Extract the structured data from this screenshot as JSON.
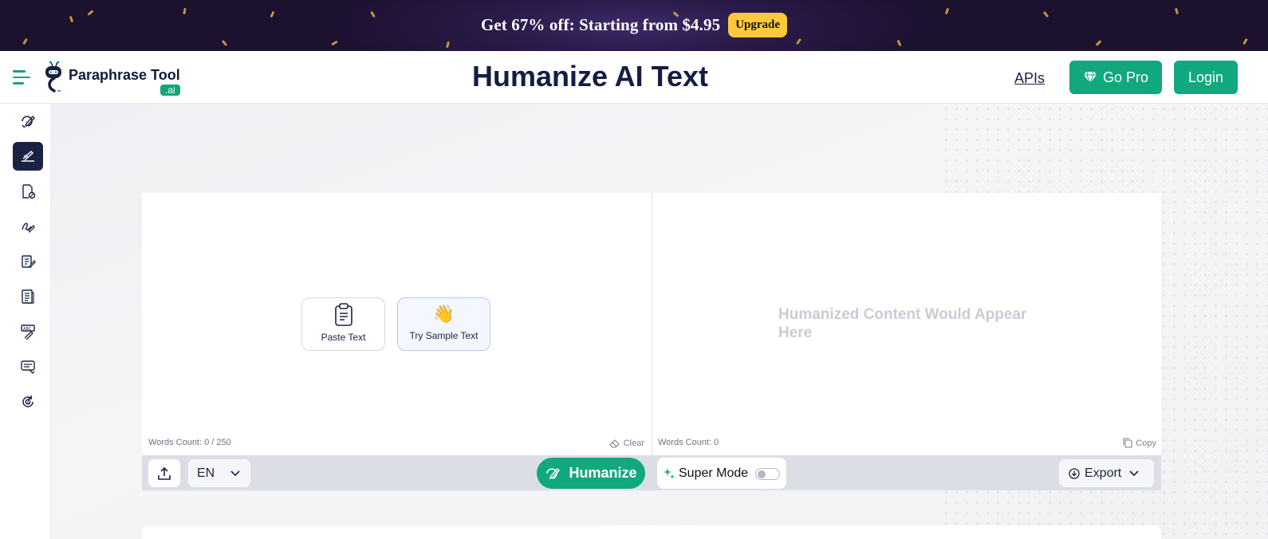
{
  "promo": {
    "text": "Get 67% off: Starting from $4.95",
    "upgrade_label": "Upgrade"
  },
  "header": {
    "logo_text": "Paraphrase Tool",
    "logo_suffix": ".ai",
    "title": "Humanize AI Text",
    "apis_label": "APIs",
    "gopro_label": "Go Pro",
    "login_label": "Login"
  },
  "sidebar": {
    "items": [
      {
        "icon": "paraphrase-pen-icon",
        "active": false
      },
      {
        "icon": "humanize-hand-pen-icon",
        "active": true
      },
      {
        "icon": "document-check-icon",
        "active": false
      },
      {
        "icon": "signature-pen-icon",
        "active": false
      },
      {
        "icon": "document-edit-icon",
        "active": false
      },
      {
        "icon": "document-lines-icon",
        "active": false
      },
      {
        "icon": "grammar-check-icon",
        "active": false
      },
      {
        "icon": "chat-lines-icon",
        "active": false
      },
      {
        "icon": "ai-refresh-icon",
        "active": false
      }
    ]
  },
  "editor": {
    "paste_label": "Paste Text",
    "sample_label": "Try Sample Text",
    "sample_emoji": "👋",
    "input_words": "Words Count: 0 / 250",
    "clear_label": "Clear",
    "output_placeholder": "Humanized Content Would Appear Here",
    "output_words": "Words Count: 0",
    "copy_label": "Copy"
  },
  "toolbar": {
    "language": "EN",
    "humanize_label": "Humanize",
    "super_mode_label": "Super Mode",
    "super_mode_on": false,
    "export_label": "Export"
  },
  "colors": {
    "accent": "#12a87d",
    "navy": "#1b2244",
    "promo_bg": "#1d1130",
    "upgrade": "#ffc93c"
  }
}
